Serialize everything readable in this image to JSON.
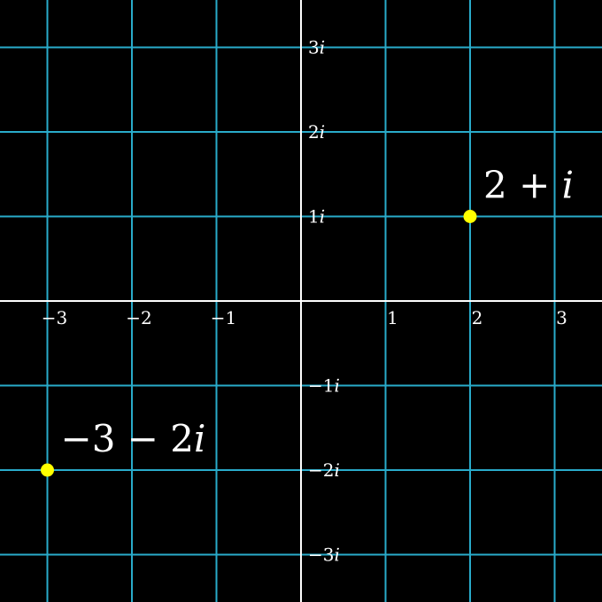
{
  "colors": {
    "background": "#000000",
    "grid": "#29abca",
    "axes": "#ffffff",
    "point": "#ffff00",
    "text": "#ffffff"
  },
  "plane": {
    "real_range": [
      -3,
      3
    ],
    "imag_range": [
      -3,
      3
    ],
    "real_tick_labels": [
      {
        "value": -3,
        "text": "−3"
      },
      {
        "value": -2,
        "text": "−2"
      },
      {
        "value": -1,
        "text": "−1"
      },
      {
        "value": 1,
        "text": "1"
      },
      {
        "value": 2,
        "text": "2"
      },
      {
        "value": 3,
        "text": "3"
      }
    ],
    "imag_tick_labels": [
      {
        "value": 3,
        "coef": "3",
        "unit": "i"
      },
      {
        "value": 2,
        "coef": "2",
        "unit": "i"
      },
      {
        "value": 1,
        "coef": "1",
        "unit": "i"
      },
      {
        "value": -1,
        "coef": "−1",
        "unit": "i"
      },
      {
        "value": -2,
        "coef": "−2",
        "unit": "i"
      },
      {
        "value": -3,
        "coef": "−3",
        "unit": "i"
      }
    ]
  },
  "points": [
    {
      "re": 2,
      "im": 1,
      "label_real": "2 + ",
      "label_unit": "i"
    },
    {
      "re": -3,
      "im": -2,
      "label_real": "−3 − 2",
      "label_unit": "i"
    }
  ]
}
